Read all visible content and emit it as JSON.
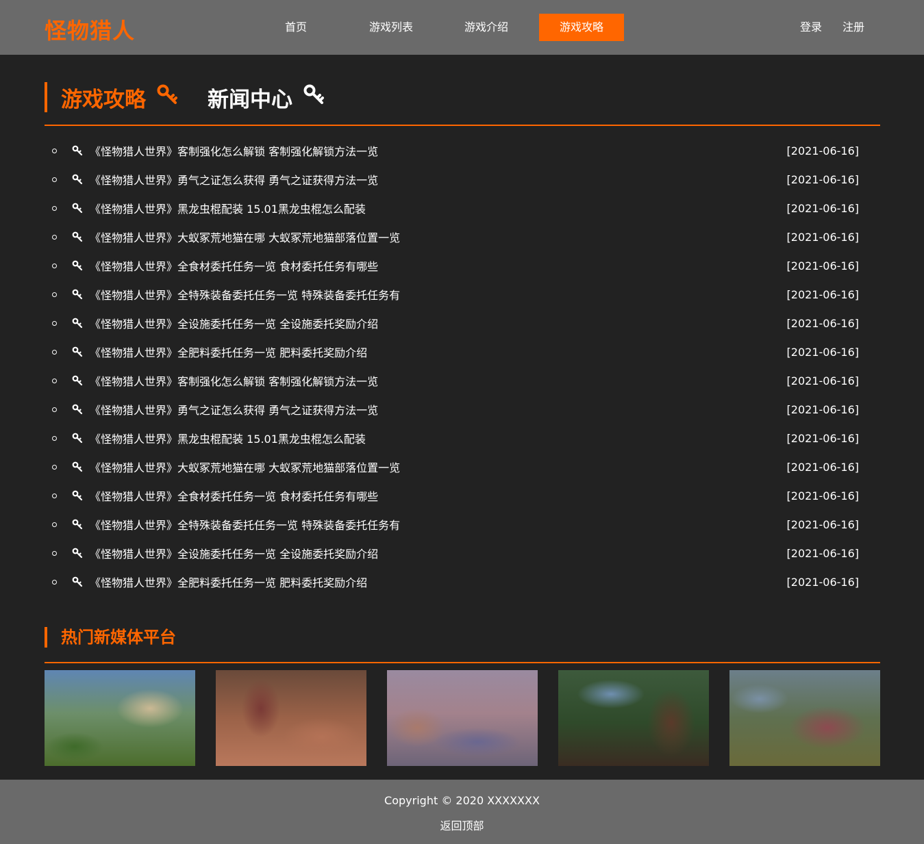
{
  "header": {
    "logo": "怪物猎人",
    "nav": [
      {
        "label": "首页"
      },
      {
        "label": "游戏列表"
      },
      {
        "label": "游戏介绍"
      },
      {
        "label": "游戏攻略"
      }
    ],
    "active_nav": "游戏攻略",
    "auth": {
      "login": "登录",
      "register": "注册"
    }
  },
  "main": {
    "tabs": [
      {
        "label": "游戏攻略",
        "icon": "key-icon"
      },
      {
        "label": "新闻中心",
        "icon": "key-icon"
      }
    ],
    "articles": [
      {
        "title": "《怪物猎人世界》客制强化怎么解锁 客制强化解锁方法一览",
        "date": "[2021-06-16]"
      },
      {
        "title": "《怪物猎人世界》勇气之证怎么获得 勇气之证获得方法一览",
        "date": "[2021-06-16]"
      },
      {
        "title": "《怪物猎人世界》黑龙虫棍配装 15.01黑龙虫棍怎么配装",
        "date": "[2021-06-16]"
      },
      {
        "title": "《怪物猎人世界》大蚁冢荒地猫在哪 大蚁冢荒地猫部落位置一览",
        "date": "[2021-06-16]"
      },
      {
        "title": "《怪物猎人世界》全食材委托任务一览 食材委托任务有哪些",
        "date": "[2021-06-16]"
      },
      {
        "title": "《怪物猎人世界》全特殊装备委托任务一览 特殊装备委托任务有",
        "date": "[2021-06-16]"
      },
      {
        "title": "《怪物猎人世界》全设施委托任务一览 全设施委托奖励介绍",
        "date": "[2021-06-16]"
      },
      {
        "title": "《怪物猎人世界》全肥料委托任务一览 肥料委托奖励介绍",
        "date": "[2021-06-16]"
      },
      {
        "title": "《怪物猎人世界》客制强化怎么解锁 客制强化解锁方法一览",
        "date": "[2021-06-16]"
      },
      {
        "title": "《怪物猎人世界》勇气之证怎么获得 勇气之证获得方法一览",
        "date": "[2021-06-16]"
      },
      {
        "title": "《怪物猎人世界》黑龙虫棍配装 15.01黑龙虫棍怎么配装",
        "date": "[2021-06-16]"
      },
      {
        "title": "《怪物猎人世界》大蚁冢荒地猫在哪 大蚁冢荒地猫部落位置一览",
        "date": "[2021-06-16]"
      },
      {
        "title": "《怪物猎人世界》全食材委托任务一览 食材委托任务有哪些",
        "date": "[2021-06-16]"
      },
      {
        "title": "《怪物猎人世界》全特殊装备委托任务一览 特殊装备委托任务有",
        "date": "[2021-06-16]"
      },
      {
        "title": "《怪物猎人世界》全设施委托任务一览 全设施委托奖励介绍",
        "date": "[2021-06-16]"
      },
      {
        "title": "《怪物猎人世界》全肥料委托任务一览 肥料委托奖励介绍",
        "date": "[2021-06-16]"
      }
    ],
    "media": {
      "heading": "热门新媒体平台"
    }
  },
  "footer": {
    "copyright": "Copyright © 2020 XXXXXXX",
    "back_to_top": "返回顶部"
  },
  "colors": {
    "accent": "#ff6600",
    "background": "#222222",
    "bar": "#6a6a6a",
    "text": "#ffffff"
  }
}
